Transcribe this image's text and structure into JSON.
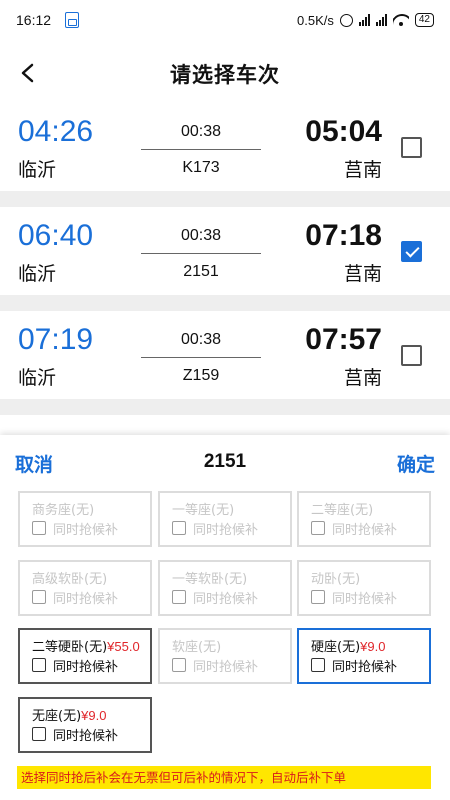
{
  "status_bar": {
    "time": "16:12",
    "net_speed": "0.5K/s",
    "battery": "42"
  },
  "header": {
    "title": "请选择车次"
  },
  "trains": [
    {
      "dep_time": "04:26",
      "dep_station": "临沂",
      "duration": "00:38",
      "train_no": "K173",
      "arr_time": "05:04",
      "arr_station": "莒南",
      "checked": false
    },
    {
      "dep_time": "06:40",
      "dep_station": "临沂",
      "duration": "00:38",
      "train_no": "2151",
      "arr_time": "07:18",
      "arr_station": "莒南",
      "checked": true
    },
    {
      "dep_time": "07:19",
      "dep_station": "临沂",
      "duration": "00:38",
      "train_no": "Z159",
      "arr_time": "07:57",
      "arr_station": "莒南",
      "checked": false
    }
  ],
  "sheet": {
    "cancel_label": "取消",
    "confirm_label": "确定",
    "title": "2151",
    "seats": [
      {
        "name": "商务座(无)",
        "price": "",
        "alt": "同时抢候补",
        "state": "disabled"
      },
      {
        "name": "一等座(无)",
        "price": "",
        "alt": "同时抢候补",
        "state": "disabled"
      },
      {
        "name": "二等座(无)",
        "price": "",
        "alt": "同时抢候补",
        "state": "disabled"
      },
      {
        "name": "高级软卧(无)",
        "price": "",
        "alt": "同时抢候补",
        "state": "disabled"
      },
      {
        "name": "一等软卧(无)",
        "price": "",
        "alt": "同时抢候补",
        "state": "disabled"
      },
      {
        "name": "动卧(无)",
        "price": "",
        "alt": "同时抢候补",
        "state": "disabled"
      },
      {
        "name": "二等硬卧(无)",
        "price": "¥55.0",
        "alt": "同时抢候补",
        "state": "available"
      },
      {
        "name": "软座(无)",
        "price": "",
        "alt": "同时抢候补",
        "state": "disabled"
      },
      {
        "name": "硬座(无)",
        "price": "¥9.0",
        "alt": "同时抢候补",
        "state": "selected"
      },
      {
        "name": "无座(无)",
        "price": "¥9.0",
        "alt": "同时抢候补",
        "state": "available"
      }
    ],
    "notice": "选择同时抢后补会在无票但可后补的情况下，自动后补下单"
  },
  "colors": {
    "accent": "#1a6fd8",
    "price": "#e0262b",
    "notice_bg": "#ffe600",
    "notice_text": "#d81b1b"
  }
}
